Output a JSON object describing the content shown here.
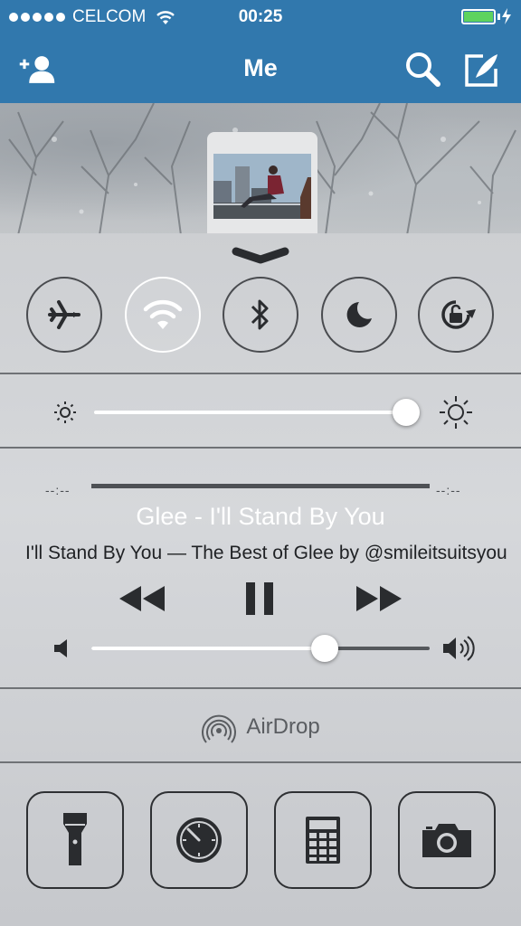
{
  "status_bar": {
    "carrier": "CELCOM",
    "time": "00:25",
    "battery_level": 1.0,
    "signal_bars": 5
  },
  "nav": {
    "title": "Me",
    "icons": [
      "add-user-icon",
      "search-icon",
      "compose-icon"
    ]
  },
  "control_center": {
    "toggles": [
      {
        "name": "airplane-mode",
        "on": false
      },
      {
        "name": "wifi",
        "on": true
      },
      {
        "name": "bluetooth",
        "on": false
      },
      {
        "name": "do-not-disturb",
        "on": false
      },
      {
        "name": "rotation-lock",
        "on": false
      }
    ],
    "brightness_level": 0.98,
    "music": {
      "elapsed": "--:--",
      "remaining": "--:--",
      "title": "Glee - I'll Stand By You",
      "subtitle": "I'll Stand By You — The Best of Glee by @smileitsuitsyou",
      "volume_level": 0.69,
      "playing": true
    },
    "airdrop_label": "AirDrop",
    "tools": [
      "flashlight-icon",
      "timer-icon",
      "calculator-icon",
      "camera-icon"
    ]
  },
  "colors": {
    "nav_bar": "#3178ad",
    "battery_fill": "#5ed35e",
    "toggle_on": "#ffffff"
  }
}
